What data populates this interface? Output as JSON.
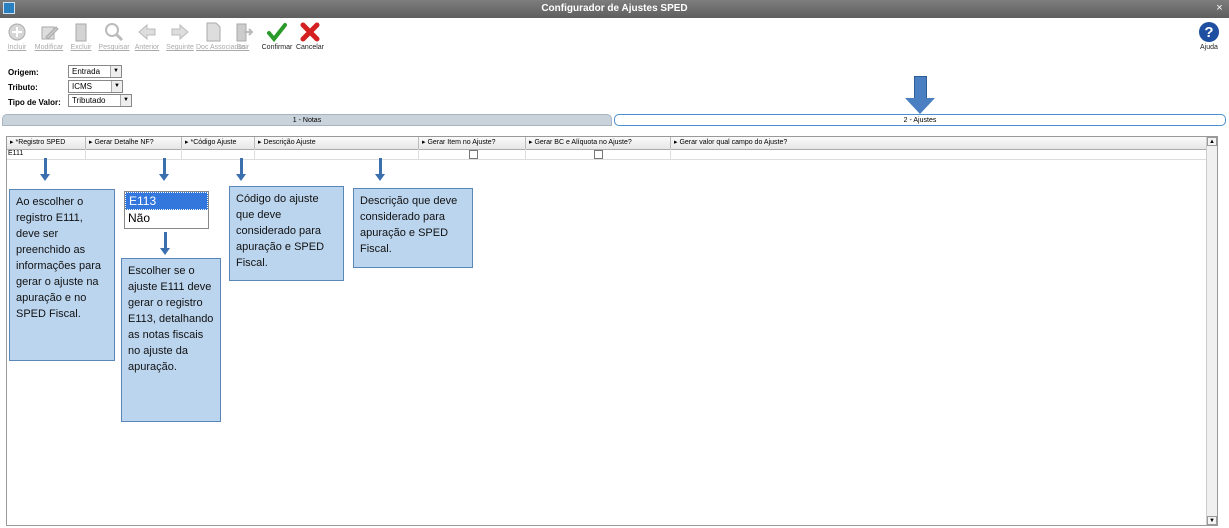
{
  "window": {
    "title": "Configurador de Ajustes SPED",
    "close_glyph": "×"
  },
  "toolbar": {
    "buttons": [
      {
        "label": "Incluir",
        "icon": "add-icon"
      },
      {
        "label": "Modificar",
        "icon": "edit-icon"
      },
      {
        "label": "Excluir",
        "icon": "trash-icon"
      },
      {
        "label": "Pesquisar",
        "icon": "search-icon"
      },
      {
        "label": "Anterior",
        "icon": "arrow-left-icon"
      },
      {
        "label": "Seguinte",
        "icon": "arrow-right-icon"
      },
      {
        "label": "Doc Associados",
        "icon": "document-icon"
      },
      {
        "label": "Sair",
        "icon": "exit-icon"
      },
      {
        "label": "Confirmar",
        "icon": "check-icon"
      },
      {
        "label": "Cancelar",
        "icon": "cancel-icon"
      }
    ],
    "help_label": "Ajuda"
  },
  "form": {
    "origem": {
      "label": "Origem:",
      "value": "Entrada"
    },
    "tributo": {
      "label": "Tributo:",
      "value": "ICMS"
    },
    "tipo_valor": {
      "label": "Tipo de Valor:",
      "value": "Tributado"
    }
  },
  "tabs": [
    {
      "label": "1 - Notas"
    },
    {
      "label": "2 - Ajustes"
    }
  ],
  "grid": {
    "columns": [
      "*Registro SPED",
      "Gerar Detalhe NF?",
      "*Código Ajuste",
      "Descrição Ajuste",
      "Gerar Item no Ajuste?",
      "Gerar BC e Alíquota no Ajuste?",
      "Gerar valor qual campo do Ajuste?"
    ],
    "rows": [
      {
        "registro": "E111"
      }
    ]
  },
  "dropdown": {
    "options": [
      "E113",
      "Não"
    ],
    "selected_index": 0
  },
  "notes": {
    "registro": "Ao escolher o registro E111, deve ser preenchido as informações para gerar o ajuste na apuração e no SPED Fiscal.",
    "detalhe": "Escolher se o ajuste E111 deve gerar o registro E113, detalhando as notas fiscais no ajuste da apuração.",
    "codigo": "Código do ajuste que deve considerado para apuração e SPED Fiscal.",
    "descricao": "Descrição que deve considerado para apuração e SPED Fiscal."
  },
  "colors": {
    "accent": "#3b6fae",
    "note_bg": "#bcd5ee",
    "confirm": "#2a9a2a",
    "cancel": "#d42020"
  }
}
